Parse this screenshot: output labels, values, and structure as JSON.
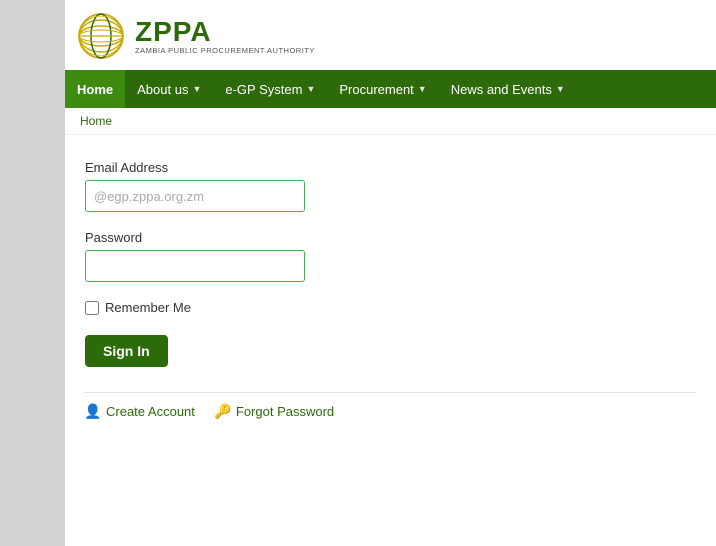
{
  "header": {
    "logo_zppa": "ZPPA",
    "logo_subtitle": "ZAMBIA PUBLIC PROCUREMENT AUTHORITY"
  },
  "nav": {
    "items": [
      {
        "label": "Home",
        "active": true,
        "has_arrow": false
      },
      {
        "label": "About us",
        "active": false,
        "has_arrow": true
      },
      {
        "label": "e-GP System",
        "active": false,
        "has_arrow": true
      },
      {
        "label": "Procurement",
        "active": false,
        "has_arrow": true
      },
      {
        "label": "News and Events",
        "active": false,
        "has_arrow": true
      }
    ]
  },
  "breadcrumb": {
    "home_label": "Home"
  },
  "form": {
    "email_label": "Email Address",
    "email_placeholder": "@egp.zppa.org.zm",
    "password_label": "Password",
    "remember_me_label": "Remember Me",
    "sign_in_label": "Sign In"
  },
  "bottom_links": {
    "create_account_label": "Create Account",
    "forgot_password_label": "Forgot Password"
  }
}
